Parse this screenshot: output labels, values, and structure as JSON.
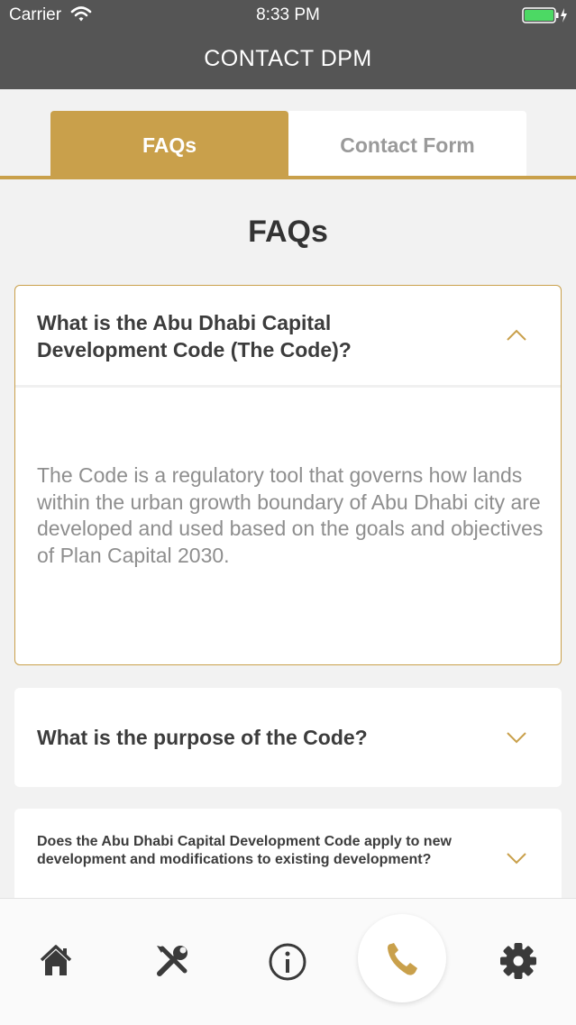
{
  "status_bar": {
    "carrier": "Carrier",
    "time": "8:33 PM"
  },
  "header": {
    "title": "CONTACT DPM"
  },
  "tabs": [
    {
      "label": "FAQs",
      "active": true
    },
    {
      "label": "Contact Form",
      "active": false
    }
  ],
  "section_title": "FAQs",
  "faqs": [
    {
      "question": "What is the Abu Dhabi Capital Development Code (The Code)?",
      "answer": "The Code is a regulatory tool that governs how lands within the urban growth boundary of Abu Dhabi city are developed and used based on the goals and objectives of Plan Capital 2030.",
      "expanded": true
    },
    {
      "question": "What is the purpose of the Code?",
      "expanded": false
    },
    {
      "question": "Does the Abu Dhabi Capital Development Code apply to new development and modifications to existing development?",
      "expanded": false
    }
  ],
  "bottom_nav": [
    {
      "icon": "home-icon",
      "active": false
    },
    {
      "icon": "tools-icon",
      "active": false
    },
    {
      "icon": "info-icon",
      "active": false
    },
    {
      "icon": "phone-icon",
      "active": true
    },
    {
      "icon": "gear-icon",
      "active": false
    }
  ],
  "colors": {
    "accent": "#c9a04b",
    "header": "#555555",
    "background": "#f2f2f2",
    "icon": "#3a3a3a",
    "battery": "#4cd964"
  }
}
